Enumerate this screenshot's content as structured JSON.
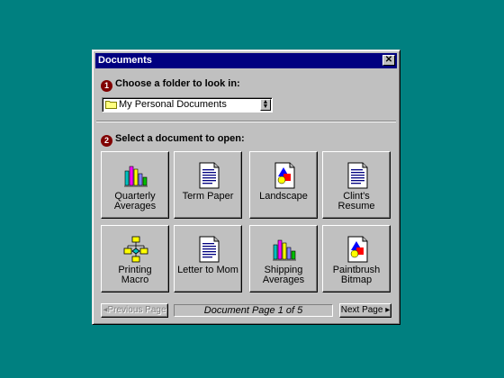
{
  "window": {
    "title": "Documents",
    "close_label": "✕"
  },
  "step1": {
    "number": "1",
    "label": "Choose a folder to look in:"
  },
  "folder_select": {
    "value": "My Personal Documents",
    "icon": "folder-icon"
  },
  "step2": {
    "number": "2",
    "label": "Select a document to open:"
  },
  "documents": [
    {
      "label": "Quarterly Averages",
      "icon": "bar-chart-icon"
    },
    {
      "label": "Term Paper",
      "icon": "text-document-icon"
    },
    {
      "label": "Landscape",
      "icon": "picture-document-icon"
    },
    {
      "label": "Clint's Resume",
      "icon": "text-document-icon"
    },
    {
      "label": "Printing Macro",
      "icon": "flowchart-icon"
    },
    {
      "label": "Letter to Mom",
      "icon": "text-document-icon"
    },
    {
      "label": "Shipping Averages",
      "icon": "bar-chart-icon"
    },
    {
      "label": "Paintbrush Bitmap",
      "icon": "picture-document-icon"
    }
  ],
  "pagination": {
    "previous_label": "Previous Page",
    "next_label": "Next Page",
    "indicator": "Document Page 1 of 5"
  },
  "colors": {
    "desktop": "#008080",
    "titlebar": "#000080",
    "face": "#c0c0c0",
    "step_badge": "#800000"
  }
}
